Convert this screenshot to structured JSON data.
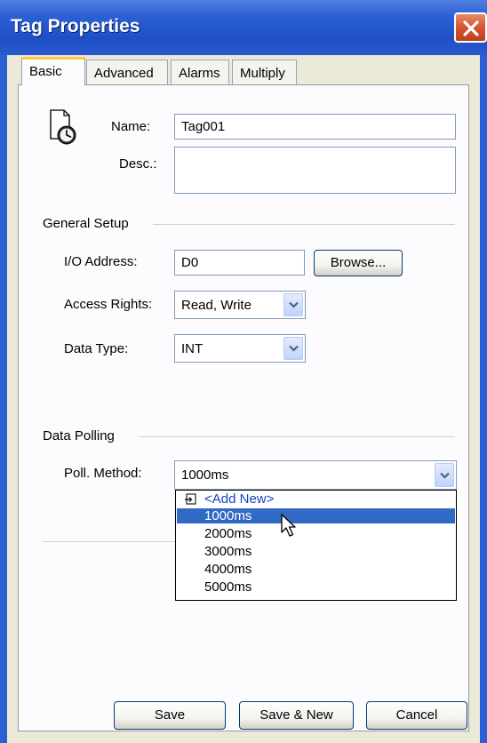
{
  "window": {
    "title": "Tag Properties"
  },
  "tabs": [
    {
      "label": "Basic",
      "active": true
    },
    {
      "label": "Advanced",
      "active": false
    },
    {
      "label": "Alarms",
      "active": false
    },
    {
      "label": "Multiply",
      "active": false
    }
  ],
  "basic": {
    "name_label": "Name:",
    "name_value": "Tag001",
    "desc_label": "Desc.:",
    "desc_value": ""
  },
  "general_setup": {
    "heading": "General Setup",
    "io_address_label": "I/O Address:",
    "io_address_value": "D0",
    "browse_label": "Browse...",
    "access_rights_label": "Access Rights:",
    "access_rights_value": "Read, Write",
    "data_type_label": "Data Type:",
    "data_type_value": "INT"
  },
  "data_polling": {
    "heading": "Data Polling",
    "poll_method_label": "Poll. Method:",
    "poll_method_value": "1000ms",
    "options": [
      "<Add New>",
      "1000ms",
      "2000ms",
      "3000ms",
      "4000ms",
      "5000ms"
    ],
    "selected_index": 1
  },
  "footer": {
    "save_label": "Save",
    "save_new_label": "Save & New",
    "cancel_label": "Cancel"
  },
  "colors": {
    "title_bar": "#2c5fd4",
    "selection": "#316ac5",
    "tab_accent": "#ffc83c",
    "close_button": "#d4552f"
  },
  "icons": {
    "tag": "tag-document-clock-icon",
    "close": "close-icon",
    "dropdown": "chevron-down-icon",
    "add_new": "add-new-icon",
    "cursor": "mouse-pointer-icon"
  }
}
